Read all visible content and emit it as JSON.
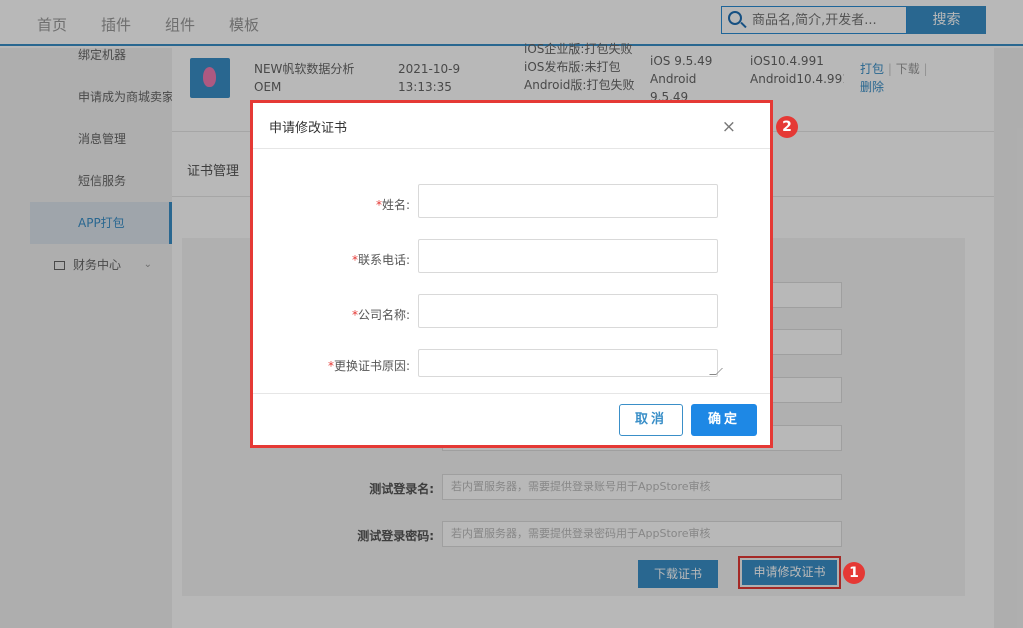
{
  "nav": {
    "items": [
      "首页",
      "插件",
      "组件",
      "模板"
    ],
    "search_placeholder": "商品名,简介,开发者...",
    "search_button": "搜索"
  },
  "sidebar": {
    "items": [
      "绑定机器",
      "申请成为商城卖家",
      "消息管理",
      "短信服务",
      "APP打包"
    ],
    "active_index": 4,
    "folder_label": "财务中心"
  },
  "app_row": {
    "name": "NEW帆软数据分析OEM",
    "date": "2021-10-9 13:13:35",
    "status_lines": [
      "iOS企业版:打包失败",
      "iOS发布版:未打包",
      "Android版:打包失败"
    ],
    "versions_a": [
      "iOS 9.5.49",
      "Android 9.5.49"
    ],
    "versions_b": [
      "iOS10.4.991",
      "Android10.4.991"
    ],
    "actions": [
      "打包",
      "下载",
      "删除"
    ]
  },
  "cert": {
    "title": "证书管理",
    "login_name_label": "测试登录名:",
    "login_name_placeholder": "若内置服务器，需要提供登录账号用于AppStore审核",
    "login_pwd_label": "测试登录密码:",
    "login_pwd_placeholder": "若内置服务器，需要提供登录密码用于AppStore审核",
    "download_button": "下载证书",
    "apply_button": "申请修改证书"
  },
  "modal": {
    "title": "申请修改证书",
    "close": "×",
    "fields": [
      {
        "label": "姓名:"
      },
      {
        "label": "联系电话:"
      },
      {
        "label": "公司名称:"
      },
      {
        "label": "更换证书原因:"
      }
    ],
    "required_mark": "*",
    "cancel": "取消",
    "ok": "确定"
  },
  "badges": [
    "1",
    "2"
  ]
}
